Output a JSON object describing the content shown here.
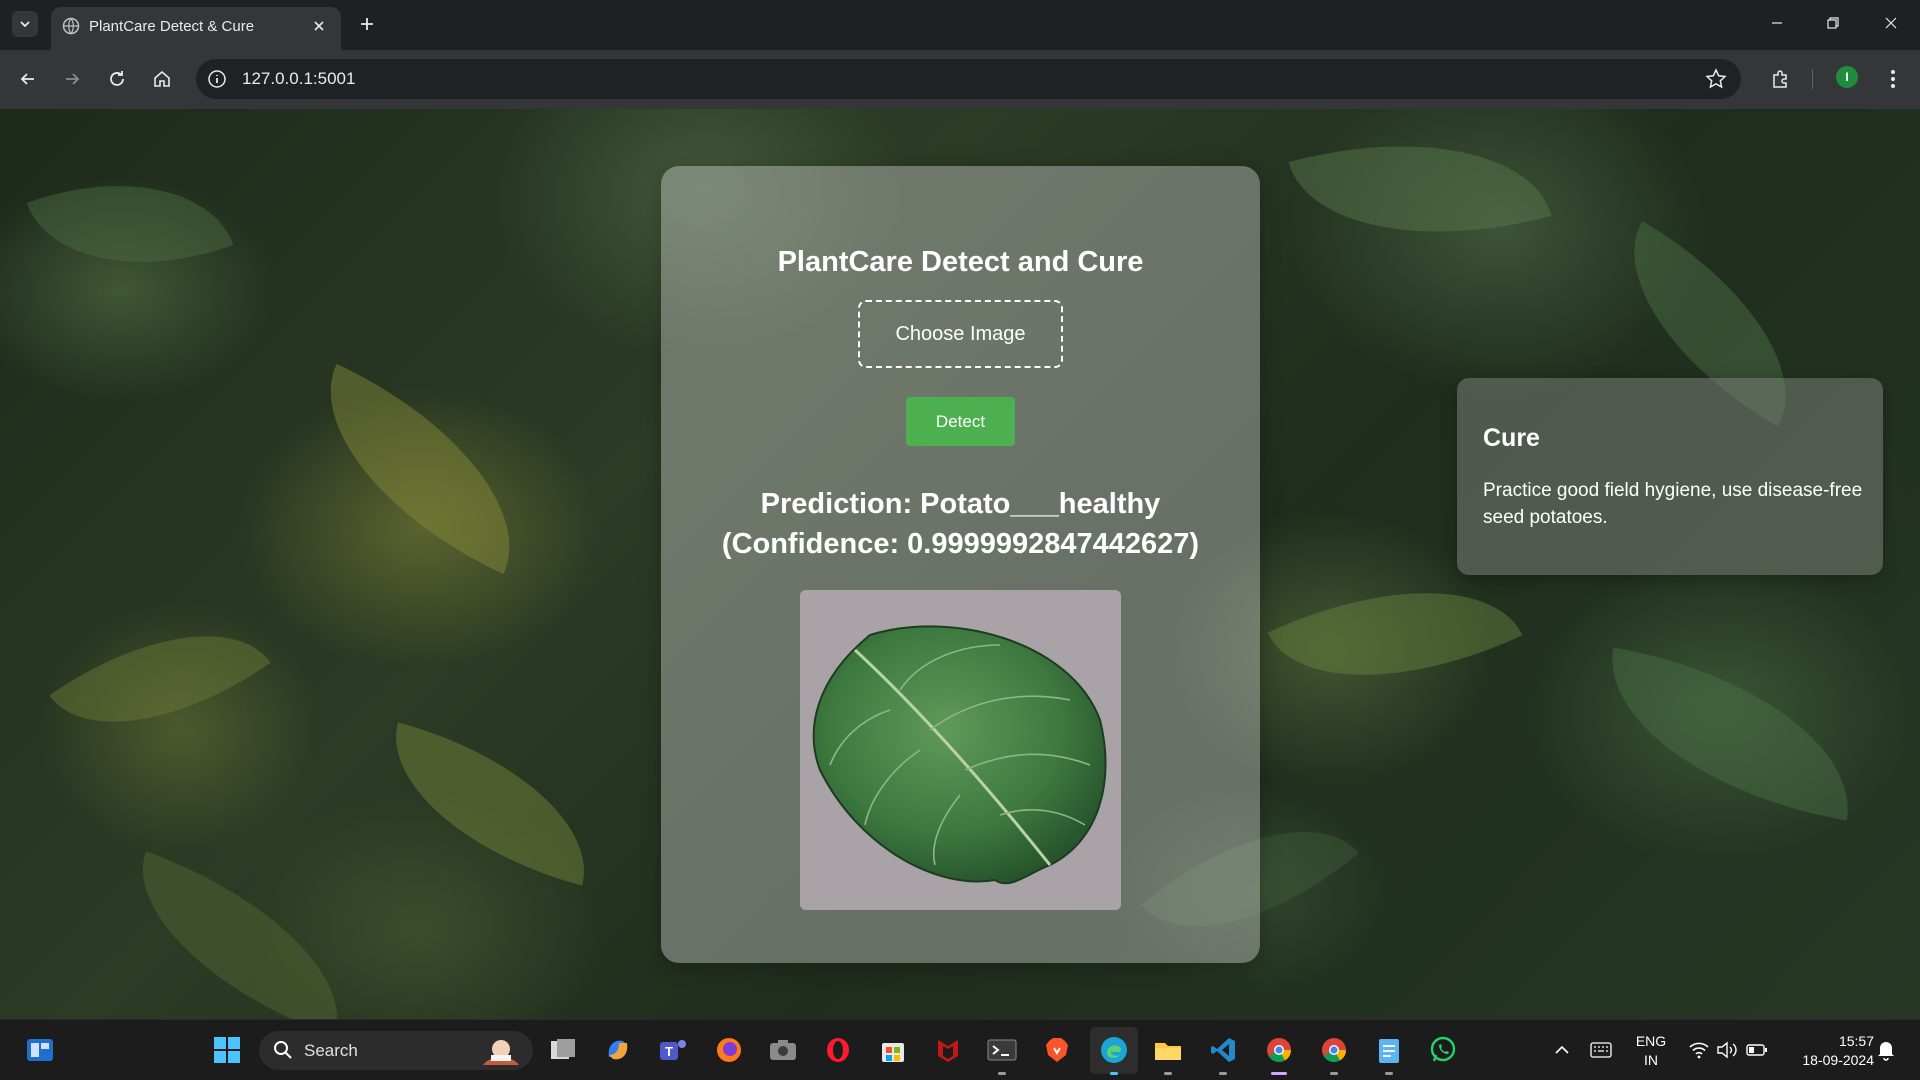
{
  "browser": {
    "tab_title": "PlantCare Detect & Cure",
    "url": "127.0.0.1:5001",
    "profile_initial": "I"
  },
  "page": {
    "title": "PlantCare Detect and Cure",
    "choose_image_label": "Choose Image",
    "detect_label": "Detect",
    "prediction_text": "Prediction: Potato___healthy (Confidence: 0.9999992847442627)",
    "cure_title": "Cure",
    "cure_text": "Practice good field hygiene, use disease-free seed potatoes."
  },
  "taskbar": {
    "search_label": "Search",
    "language": "ENG",
    "region": "IN",
    "time": "15:57",
    "date": "18-09-2024",
    "apps": [
      "file-explorer-icon",
      "copilot-icon",
      "teams-icon",
      "firefox-icon",
      "camera-icon",
      "opera-icon",
      "store-icon",
      "mcafee-icon",
      "terminal-icon",
      "brave-icon",
      "edge-icon",
      "folder-icon",
      "vscode-icon",
      "chrome-icon",
      "chrome-alt-icon",
      "notepad-icon",
      "whatsapp-icon"
    ]
  },
  "colors": {
    "detect_button": "#4caf50",
    "accent_green": "#1e8e3e"
  }
}
